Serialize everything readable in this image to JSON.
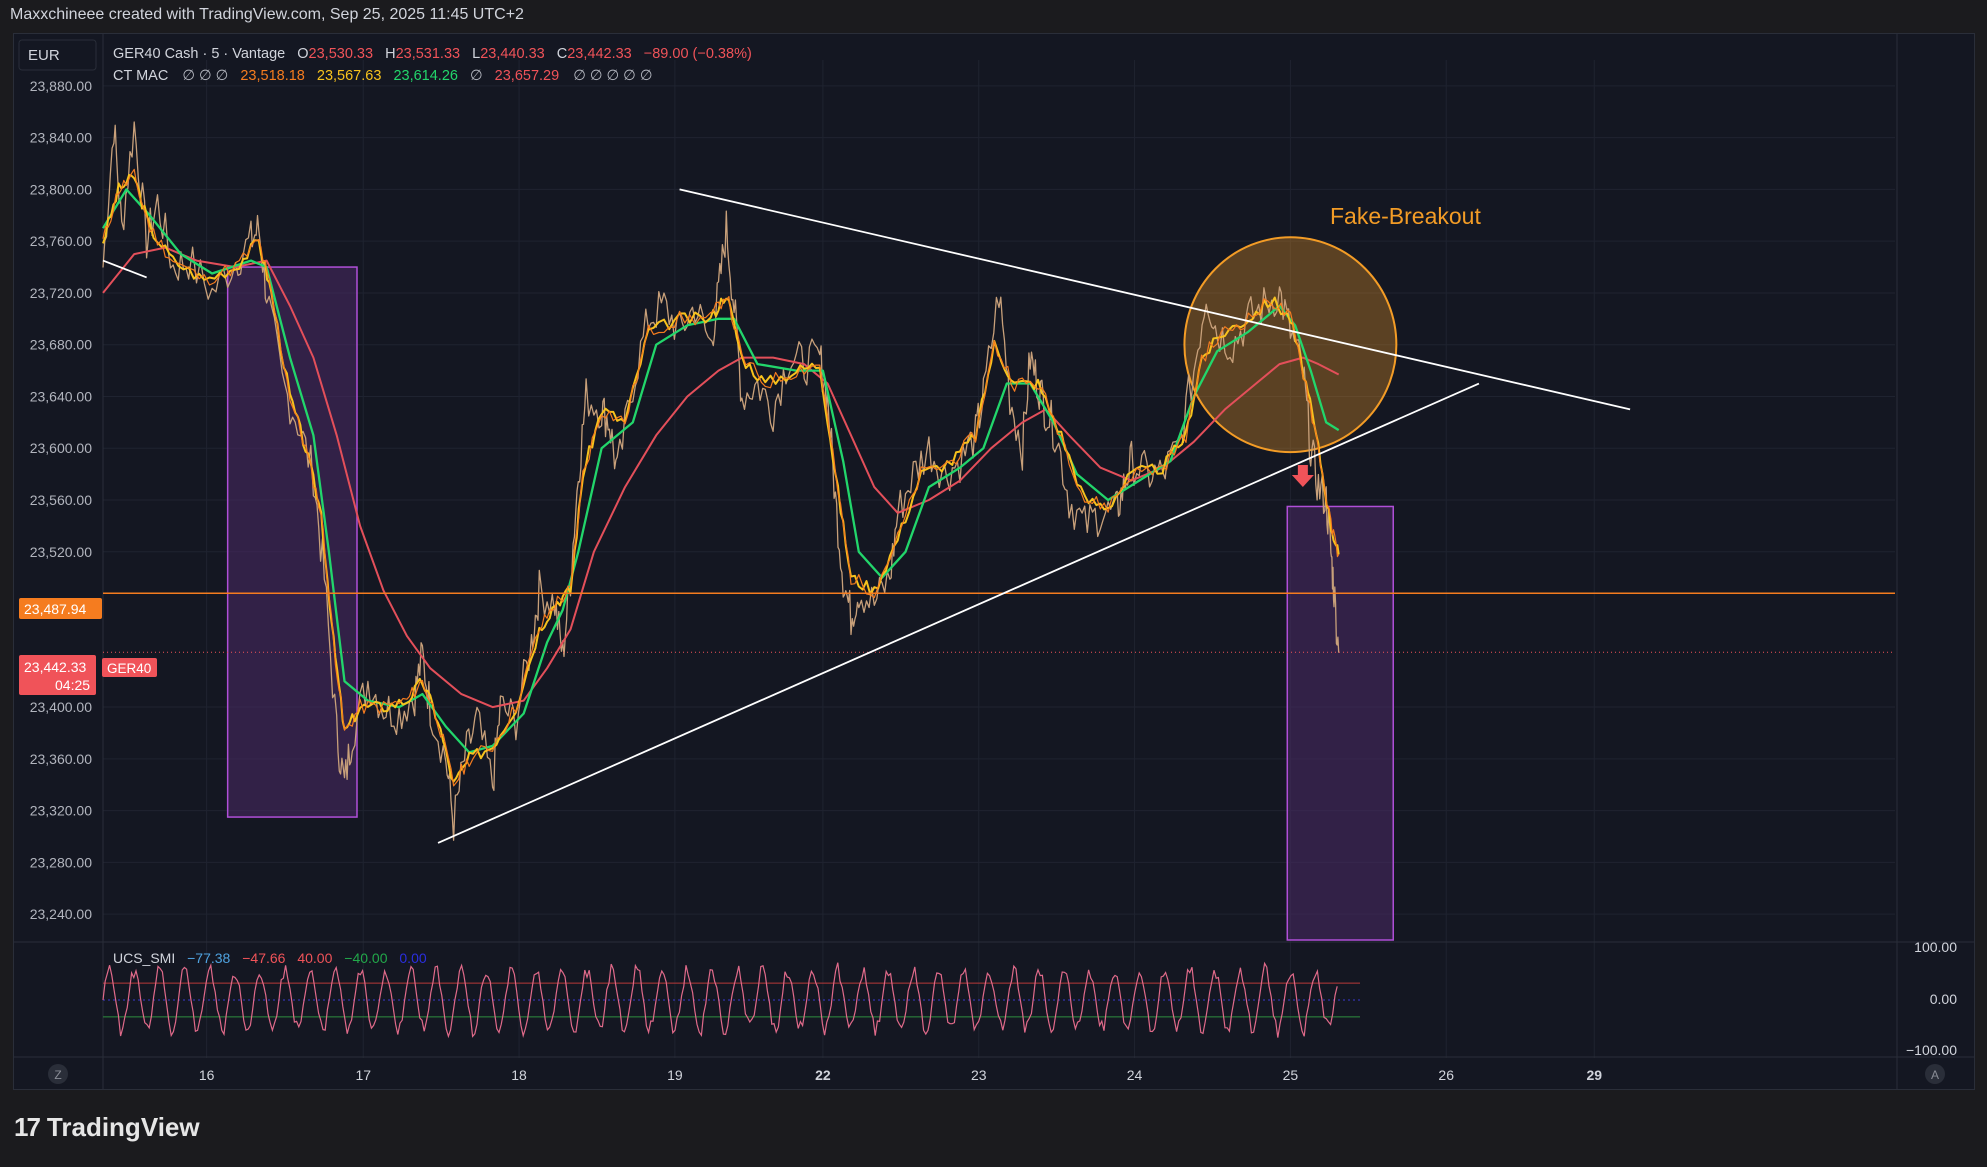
{
  "header": {
    "attribution": "Maxxchineee created with TradingView.com, Sep 25, 2025 11:45 UTC+2"
  },
  "currency_button": "EUR",
  "legend": {
    "symbol": "GER40 Cash · 5 · Vantage",
    "o_label": "O",
    "o_value": "23,530.33",
    "h_label": "H",
    "h_value": "23,531.33",
    "l_label": "L",
    "l_value": "23,440.33",
    "c_label": "C",
    "c_value": "23,442.33",
    "change": "−89.00 (−0.38%)",
    "indicator_name": "CT MAC",
    "indicator_prefix": "∅ ∅ ∅",
    "ma1": "23,518.18",
    "ma2": "23,567.63",
    "ma3": "23,614.26",
    "ma_sep": "∅",
    "ma4": "23,657.29",
    "indicator_suffix": "∅ ∅ ∅ ∅ ∅"
  },
  "osc_legend": {
    "name": "UCS_SMI",
    "v1": "−77.38",
    "v2": "−47.66",
    "v3": "40.00",
    "v4": "−40.00",
    "v5": "0.00"
  },
  "annotations": {
    "fake_breakout": "Fake-Breakout"
  },
  "price_tags": {
    "level": "23,487.94",
    "current_price": "23,442.33",
    "countdown": "04:25",
    "symbol_tag": "GER40"
  },
  "osc_axis": [
    "100.00",
    "0.00",
    "−100.00"
  ],
  "bottom_buttons": {
    "left": "Z",
    "right": "A"
  },
  "footer": {
    "logo_mark": "17",
    "brand": "TradingView"
  },
  "colors": {
    "background": "#141722",
    "price": "#c8a07a",
    "ma_fast": "#f7c21d",
    "ma_mid": "#22d66b",
    "ma_slow": "#e34f5a",
    "level_line": "#f57c1f",
    "box_fill": "#4a2a66",
    "box_stroke": "#b04fd8",
    "circle": "#f39c26",
    "trendline": "#ffffff",
    "osc": "#e06a8a"
  },
  "chart_data": {
    "type": "line",
    "title": "GER40 Cash · 5 · Vantage",
    "ylim": [
      23220,
      23900
    ],
    "y_ticks": [
      23880,
      23840,
      23800,
      23760,
      23720,
      23680,
      23640,
      23600,
      23560,
      23520,
      23400,
      23360,
      23320,
      23280,
      23240
    ],
    "y_tick_labels": [
      "23,880.00",
      "23,840.00",
      "23,800.00",
      "23,760.00",
      "23,720.00",
      "23,680.00",
      "23,640.00",
      "23,600.00",
      "23,560.00",
      "23,520.00",
      "23,400.00",
      "23,360.00",
      "23,320.00",
      "23,280.00",
      "23,240.00"
    ],
    "x_ticks": [
      "16",
      "17",
      "18",
      "19",
      "22",
      "23",
      "24",
      "25",
      "26",
      "29"
    ],
    "x_tick_bold": [
      false,
      false,
      false,
      false,
      true,
      false,
      false,
      false,
      false,
      true
    ],
    "x_tick_pos": [
      0.665,
      1.67,
      2.67,
      3.67,
      4.62,
      5.62,
      6.62,
      7.62,
      8.62,
      9.57
    ],
    "xlim": [
      0,
      11.5
    ],
    "price_path": [
      [
        0,
        23740
      ],
      [
        0.07,
        23850
      ],
      [
        0.12,
        23770
      ],
      [
        0.2,
        23850
      ],
      [
        0.28,
        23760
      ],
      [
        0.35,
        23790
      ],
      [
        0.45,
        23740
      ],
      [
        0.55,
        23745
      ],
      [
        0.7,
        23720
      ],
      [
        0.85,
        23745
      ],
      [
        0.95,
        23760
      ],
      [
        1.0,
        23770
      ],
      [
        1.05,
        23720
      ],
      [
        1.15,
        23650
      ],
      [
        1.25,
        23620
      ],
      [
        1.35,
        23580
      ],
      [
        1.42,
        23500
      ],
      [
        1.5,
        23380
      ],
      [
        1.55,
        23340
      ],
      [
        1.6,
        23380
      ],
      [
        1.7,
        23420
      ],
      [
        1.8,
        23400
      ],
      [
        1.9,
        23395
      ],
      [
        2.0,
        23410
      ],
      [
        2.05,
        23440
      ],
      [
        2.1,
        23400
      ],
      [
        2.2,
        23360
      ],
      [
        2.25,
        23310
      ],
      [
        2.32,
        23360
      ],
      [
        2.4,
        23390
      ],
      [
        2.5,
        23340
      ],
      [
        2.55,
        23400
      ],
      [
        2.65,
        23390
      ],
      [
        2.75,
        23450
      ],
      [
        2.8,
        23490
      ],
      [
        2.9,
        23480
      ],
      [
        2.95,
        23440
      ],
      [
        3.0,
        23500
      ],
      [
        3.05,
        23580
      ],
      [
        3.1,
        23640
      ],
      [
        3.2,
        23630
      ],
      [
        3.25,
        23620
      ],
      [
        3.3,
        23580
      ],
      [
        3.4,
        23650
      ],
      [
        3.5,
        23700
      ],
      [
        3.6,
        23710
      ],
      [
        3.7,
        23690
      ],
      [
        3.8,
        23710
      ],
      [
        3.9,
        23680
      ],
      [
        3.95,
        23720
      ],
      [
        4.0,
        23770
      ],
      [
        4.05,
        23710
      ],
      [
        4.1,
        23640
      ],
      [
        4.2,
        23650
      ],
      [
        4.3,
        23630
      ],
      [
        4.4,
        23670
      ],
      [
        4.5,
        23665
      ],
      [
        4.6,
        23670
      ],
      [
        4.65,
        23640
      ],
      [
        4.7,
        23560
      ],
      [
        4.75,
        23500
      ],
      [
        4.8,
        23470
      ],
      [
        4.85,
        23490
      ],
      [
        4.95,
        23480
      ],
      [
        5.05,
        23500
      ],
      [
        5.1,
        23550
      ],
      [
        5.2,
        23580
      ],
      [
        5.3,
        23600
      ],
      [
        5.4,
        23580
      ],
      [
        5.5,
        23590
      ],
      [
        5.6,
        23610
      ],
      [
        5.65,
        23640
      ],
      [
        5.75,
        23720
      ],
      [
        5.82,
        23640
      ],
      [
        5.9,
        23600
      ],
      [
        5.95,
        23670
      ],
      [
        6.0,
        23650
      ],
      [
        6.05,
        23630
      ],
      [
        6.12,
        23610
      ],
      [
        6.2,
        23560
      ],
      [
        6.3,
        23540
      ],
      [
        6.4,
        23550
      ],
      [
        6.5,
        23550
      ],
      [
        6.55,
        23570
      ],
      [
        6.6,
        23590
      ],
      [
        6.7,
        23580
      ],
      [
        6.8,
        23580
      ],
      [
        6.9,
        23600
      ],
      [
        7.0,
        23660
      ],
      [
        7.08,
        23720
      ],
      [
        7.15,
        23690
      ],
      [
        7.25,
        23680
      ],
      [
        7.35,
        23700
      ],
      [
        7.45,
        23710
      ],
      [
        7.55,
        23720
      ],
      [
        7.62,
        23690
      ],
      [
        7.7,
        23660
      ],
      [
        7.75,
        23600
      ],
      [
        7.8,
        23570
      ],
      [
        7.85,
        23560
      ],
      [
        7.88,
        23520
      ],
      [
        7.9,
        23490
      ],
      [
        7.93,
        23442
      ]
    ],
    "ma_fast_path": [
      [
        0,
        23760
      ],
      [
        0.1,
        23800
      ],
      [
        0.2,
        23810
      ],
      [
        0.3,
        23770
      ],
      [
        0.45,
        23745
      ],
      [
        0.65,
        23730
      ],
      [
        0.85,
        23740
      ],
      [
        1.0,
        23760
      ],
      [
        1.08,
        23720
      ],
      [
        1.2,
        23640
      ],
      [
        1.3,
        23600
      ],
      [
        1.4,
        23550
      ],
      [
        1.48,
        23450
      ],
      [
        1.55,
        23380
      ],
      [
        1.65,
        23400
      ],
      [
        1.8,
        23400
      ],
      [
        1.95,
        23405
      ],
      [
        2.05,
        23420
      ],
      [
        2.15,
        23390
      ],
      [
        2.25,
        23340
      ],
      [
        2.35,
        23360
      ],
      [
        2.5,
        23370
      ],
      [
        2.65,
        23400
      ],
      [
        2.8,
        23460
      ],
      [
        2.9,
        23480
      ],
      [
        3.0,
        23490
      ],
      [
        3.08,
        23580
      ],
      [
        3.2,
        23630
      ],
      [
        3.35,
        23620
      ],
      [
        3.5,
        23690
      ],
      [
        3.7,
        23700
      ],
      [
        3.9,
        23700
      ],
      [
        4.0,
        23720
      ],
      [
        4.1,
        23670
      ],
      [
        4.25,
        23650
      ],
      [
        4.45,
        23660
      ],
      [
        4.6,
        23665
      ],
      [
        4.7,
        23580
      ],
      [
        4.8,
        23500
      ],
      [
        4.95,
        23490
      ],
      [
        5.1,
        23530
      ],
      [
        5.25,
        23580
      ],
      [
        5.45,
        23590
      ],
      [
        5.6,
        23610
      ],
      [
        5.72,
        23680
      ],
      [
        5.85,
        23650
      ],
      [
        6.0,
        23650
      ],
      [
        6.15,
        23610
      ],
      [
        6.3,
        23560
      ],
      [
        6.45,
        23555
      ],
      [
        6.6,
        23580
      ],
      [
        6.8,
        23585
      ],
      [
        6.95,
        23610
      ],
      [
        7.05,
        23670
      ],
      [
        7.2,
        23690
      ],
      [
        7.35,
        23700
      ],
      [
        7.5,
        23715
      ],
      [
        7.62,
        23700
      ],
      [
        7.72,
        23650
      ],
      [
        7.8,
        23600
      ],
      [
        7.88,
        23540
      ],
      [
        7.93,
        23518
      ]
    ],
    "ma_mid_path": [
      [
        0,
        23770
      ],
      [
        0.15,
        23800
      ],
      [
        0.3,
        23780
      ],
      [
        0.5,
        23750
      ],
      [
        0.7,
        23735
      ],
      [
        0.95,
        23745
      ],
      [
        1.05,
        23740
      ],
      [
        1.2,
        23670
      ],
      [
        1.35,
        23610
      ],
      [
        1.45,
        23520
      ],
      [
        1.55,
        23420
      ],
      [
        1.7,
        23405
      ],
      [
        1.9,
        23400
      ],
      [
        2.05,
        23410
      ],
      [
        2.2,
        23385
      ],
      [
        2.35,
        23365
      ],
      [
        2.5,
        23370
      ],
      [
        2.7,
        23395
      ],
      [
        2.85,
        23450
      ],
      [
        2.95,
        23475
      ],
      [
        3.05,
        23520
      ],
      [
        3.2,
        23600
      ],
      [
        3.4,
        23620
      ],
      [
        3.55,
        23680
      ],
      [
        3.75,
        23695
      ],
      [
        3.95,
        23700
      ],
      [
        4.05,
        23700
      ],
      [
        4.2,
        23665
      ],
      [
        4.45,
        23660
      ],
      [
        4.62,
        23660
      ],
      [
        4.75,
        23590
      ],
      [
        4.85,
        23520
      ],
      [
        5.0,
        23500
      ],
      [
        5.15,
        23520
      ],
      [
        5.3,
        23570
      ],
      [
        5.5,
        23585
      ],
      [
        5.65,
        23600
      ],
      [
        5.8,
        23650
      ],
      [
        5.95,
        23650
      ],
      [
        6.1,
        23620
      ],
      [
        6.25,
        23580
      ],
      [
        6.45,
        23560
      ],
      [
        6.65,
        23575
      ],
      [
        6.85,
        23590
      ],
      [
        7.0,
        23640
      ],
      [
        7.15,
        23675
      ],
      [
        7.35,
        23690
      ],
      [
        7.55,
        23710
      ],
      [
        7.65,
        23695
      ],
      [
        7.75,
        23660
      ],
      [
        7.85,
        23620
      ],
      [
        7.93,
        23614
      ]
    ],
    "ma_slow_path": [
      [
        0,
        23720
      ],
      [
        0.2,
        23750
      ],
      [
        0.4,
        23755
      ],
      [
        0.6,
        23745
      ],
      [
        0.85,
        23740
      ],
      [
        1.05,
        23745
      ],
      [
        1.2,
        23710
      ],
      [
        1.35,
        23670
      ],
      [
        1.5,
        23610
      ],
      [
        1.65,
        23540
      ],
      [
        1.8,
        23490
      ],
      [
        1.95,
        23455
      ],
      [
        2.1,
        23430
      ],
      [
        2.3,
        23410
      ],
      [
        2.5,
        23400
      ],
      [
        2.7,
        23405
      ],
      [
        2.85,
        23430
      ],
      [
        3.0,
        23460
      ],
      [
        3.15,
        23520
      ],
      [
        3.35,
        23570
      ],
      [
        3.55,
        23610
      ],
      [
        3.75,
        23640
      ],
      [
        3.95,
        23660
      ],
      [
        4.1,
        23670
      ],
      [
        4.3,
        23670
      ],
      [
        4.5,
        23665
      ],
      [
        4.65,
        23650
      ],
      [
        4.8,
        23610
      ],
      [
        4.95,
        23570
      ],
      [
        5.1,
        23550
      ],
      [
        5.3,
        23560
      ],
      [
        5.5,
        23575
      ],
      [
        5.7,
        23600
      ],
      [
        5.9,
        23620
      ],
      [
        6.05,
        23630
      ],
      [
        6.2,
        23610
      ],
      [
        6.4,
        23585
      ],
      [
        6.6,
        23575
      ],
      [
        6.8,
        23585
      ],
      [
        7.0,
        23605
      ],
      [
        7.2,
        23630
      ],
      [
        7.4,
        23650
      ],
      [
        7.55,
        23665
      ],
      [
        7.7,
        23670
      ],
      [
        7.8,
        23665
      ],
      [
        7.93,
        23657
      ]
    ],
    "level_line": 23487.94,
    "current_price": 23442.33,
    "trendlines": [
      {
        "from": [
          3.7,
          23800
        ],
        "to": [
          9.8,
          23630
        ]
      },
      {
        "from": [
          2.15,
          23295
        ],
        "to": [
          8.83,
          23650
        ]
      },
      {
        "from": [
          0.0,
          23745
        ],
        "to": [
          0.28,
          23732
        ]
      }
    ],
    "boxes": [
      {
        "x": [
          0.8,
          1.63
        ],
        "y": [
          23315,
          23740
        ]
      },
      {
        "x": [
          7.6,
          8.28
        ],
        "y": [
          23220,
          23555
        ]
      }
    ],
    "circle": {
      "center": [
        7.62,
        23680
      ],
      "rx": 0.68,
      "ry": 83
    },
    "arrow_down": [
      7.7,
      23570
    ],
    "oscillator": {
      "ylim": [
        -130,
        130
      ],
      "levels": [
        40,
        -40
      ],
      "amplitude": 90
    }
  }
}
